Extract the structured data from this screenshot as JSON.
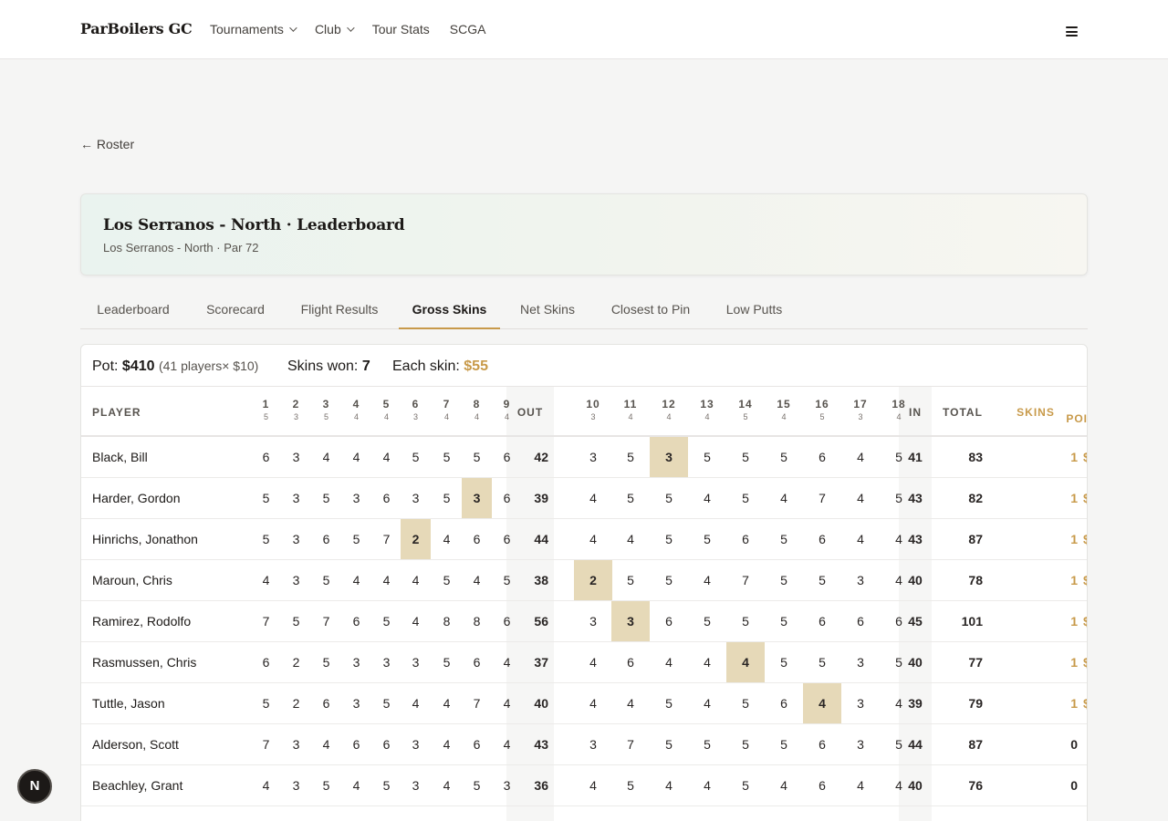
{
  "header": {
    "brand": "ParBoilers GC",
    "nav": [
      {
        "label": "Tournaments",
        "dropdown": true
      },
      {
        "label": "Club",
        "dropdown": true
      },
      {
        "label": "Tour Stats",
        "dropdown": false
      },
      {
        "label": "SCGA",
        "dropdown": false
      }
    ],
    "menu_icon": "hamburger-menu-icon"
  },
  "back_link": "← Roster",
  "hero": {
    "title": "Los Serranos - North · Leaderboard",
    "subtitle": "Los Serranos - North · Par 72"
  },
  "tabs": [
    {
      "label": "Leaderboard",
      "active": false
    },
    {
      "label": "Scorecard",
      "active": false
    },
    {
      "label": "Flight Results",
      "active": false
    },
    {
      "label": "Gross Skins",
      "active": true
    },
    {
      "label": "Net Skins",
      "active": false
    },
    {
      "label": "Closest to Pin",
      "active": false
    },
    {
      "label": "Low Putts",
      "active": false
    }
  ],
  "summary": {
    "pot_label": "Pot:",
    "pot_value": "$410",
    "pot_detail": "(41 players× $10)",
    "skins_won_label": "Skins won:",
    "skins_won_value": "7",
    "each_skin_label": "Each skin:",
    "each_skin_value": "$55"
  },
  "table": {
    "player_header": "PLAYER",
    "out_header": "OUT",
    "in_header": "IN",
    "total_header": "TOTAL",
    "skins_header": "SKINS",
    "points_header": "POIN",
    "holes": [
      {
        "hole": "1",
        "par": "5"
      },
      {
        "hole": "2",
        "par": "3"
      },
      {
        "hole": "3",
        "par": "5"
      },
      {
        "hole": "4",
        "par": "4"
      },
      {
        "hole": "5",
        "par": "4"
      },
      {
        "hole": "6",
        "par": "3"
      },
      {
        "hole": "7",
        "par": "4"
      },
      {
        "hole": "8",
        "par": "4"
      },
      {
        "hole": "9",
        "par": "4"
      },
      {
        "hole": "10",
        "par": "3"
      },
      {
        "hole": "11",
        "par": "4"
      },
      {
        "hole": "12",
        "par": "4"
      },
      {
        "hole": "13",
        "par": "4"
      },
      {
        "hole": "14",
        "par": "5"
      },
      {
        "hole": "15",
        "par": "4"
      },
      {
        "hole": "16",
        "par": "5"
      },
      {
        "hole": "17",
        "par": "3"
      },
      {
        "hole": "18",
        "par": "4"
      }
    ],
    "rows": [
      {
        "player": "Black, Bill",
        "scores": [
          6,
          3,
          4,
          4,
          4,
          5,
          5,
          5,
          6,
          3,
          5,
          3,
          5,
          5,
          5,
          6,
          4,
          5
        ],
        "out": "42",
        "in": "41",
        "total": "83",
        "skins": "1",
        "points": "$",
        "skin_holes": [
          12
        ]
      },
      {
        "player": "Harder, Gordon",
        "scores": [
          5,
          3,
          5,
          3,
          6,
          3,
          5,
          3,
          6,
          4,
          5,
          5,
          4,
          5,
          4,
          7,
          4,
          5
        ],
        "out": "39",
        "in": "43",
        "total": "82",
        "skins": "1",
        "points": "$",
        "skin_holes": [
          8
        ]
      },
      {
        "player": "Hinrichs, Jonathon",
        "scores": [
          5,
          3,
          6,
          5,
          7,
          2,
          4,
          6,
          6,
          4,
          4,
          5,
          5,
          6,
          5,
          6,
          4,
          4
        ],
        "out": "44",
        "in": "43",
        "total": "87",
        "skins": "1",
        "points": "$",
        "skin_holes": [
          6
        ]
      },
      {
        "player": "Maroun, Chris",
        "scores": [
          4,
          3,
          5,
          4,
          4,
          4,
          5,
          4,
          5,
          2,
          5,
          5,
          4,
          7,
          5,
          5,
          3,
          4
        ],
        "out": "38",
        "in": "40",
        "total": "78",
        "skins": "1",
        "points": "$",
        "skin_holes": [
          10
        ]
      },
      {
        "player": "Ramirez, Rodolfo",
        "scores": [
          7,
          5,
          7,
          6,
          5,
          4,
          8,
          8,
          6,
          3,
          3,
          6,
          5,
          5,
          5,
          6,
          6,
          6
        ],
        "out": "56",
        "in": "45",
        "total": "101",
        "skins": "1",
        "points": "$",
        "skin_holes": [
          11
        ]
      },
      {
        "player": "Rasmussen, Chris",
        "scores": [
          6,
          2,
          5,
          3,
          3,
          3,
          5,
          6,
          4,
          4,
          6,
          4,
          4,
          4,
          5,
          5,
          3,
          5
        ],
        "out": "37",
        "in": "40",
        "total": "77",
        "skins": "1",
        "points": "$",
        "skin_holes": [
          14
        ]
      },
      {
        "player": "Tuttle, Jason",
        "scores": [
          5,
          2,
          6,
          3,
          5,
          4,
          4,
          7,
          4,
          4,
          4,
          5,
          4,
          5,
          6,
          4,
          3,
          4
        ],
        "out": "40",
        "in": "39",
        "total": "79",
        "skins": "1",
        "points": "$",
        "skin_holes": [
          16
        ]
      },
      {
        "player": "Alderson, Scott",
        "scores": [
          7,
          3,
          4,
          6,
          6,
          3,
          4,
          6,
          4,
          3,
          7,
          5,
          5,
          5,
          5,
          6,
          3,
          5
        ],
        "out": "43",
        "in": "44",
        "total": "87",
        "skins": "0",
        "points": "",
        "skin_holes": []
      },
      {
        "player": "Beachley, Grant",
        "scores": [
          4,
          3,
          5,
          4,
          5,
          3,
          4,
          5,
          3,
          4,
          5,
          4,
          4,
          5,
          4,
          6,
          4,
          4
        ],
        "out": "36",
        "in": "40",
        "total": "76",
        "skins": "0",
        "points": "",
        "skin_holes": []
      }
    ]
  },
  "colors": {
    "accent_gold": "#c89a4a",
    "skin_highlight": "#e6d9b8"
  },
  "dev_badge": "N"
}
